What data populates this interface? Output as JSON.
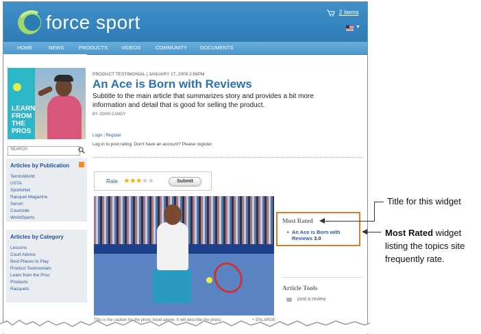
{
  "header": {
    "logo_text": "force sport",
    "cart_label": "2 items"
  },
  "nav": {
    "items": [
      "HOME",
      "NEWS",
      "PRODUCTS",
      "VIDEOS",
      "COMMUNITY",
      "DOCUMENTS"
    ]
  },
  "sidebar": {
    "promo_text": [
      "LEARN",
      "FROM",
      "THE",
      "PROS"
    ],
    "search_placeholder": "SEARCH",
    "publication": {
      "title": "Articles by Publication",
      "items": [
        "TennisWorld",
        "USTA",
        "SportsNet",
        "Racquet Magazine",
        "Serve!",
        "Courtside",
        "WorldSports"
      ]
    },
    "category": {
      "title": "Articles by Category",
      "items": [
        "Lessons",
        "Court Advice",
        "Best Places to Play",
        "Product Testimonials",
        "Learn from the Pros",
        "Products",
        "Racquets"
      ]
    }
  },
  "article": {
    "kicker": "PRODUCT TESTIMONIAL  |  JANUARY 17, 2009 2:56PM",
    "title": "An Ace is Born with Reviews",
    "subtitle": "Subtitle to the main article that summarizes story and provides a bit more information and detail that is good for selling the product.",
    "byline": "BY JOHN CANDY",
    "login": "Login",
    "register": "Register",
    "post_message": "Log in to post rating. Don't have an account? Please register.",
    "caption": "This is the caption for the photo listed above. It will describe the photo.",
    "enlarge": "+ ENLARGE"
  },
  "rating": {
    "label": "Rate",
    "stars_filled": 3,
    "stars_total": 5,
    "submit_label": "Submit"
  },
  "most_rated": {
    "title": "Most Rated",
    "items": [
      {
        "label": "An Ace is Born with Reviews",
        "score": "3.0"
      }
    ]
  },
  "article_tools": {
    "title": "Article Tools",
    "post_review": "post a review"
  },
  "callouts": {
    "title_label": "Title for this widget",
    "widget_bold": "Most Rated",
    "widget_rest": " widget listing the topics site frequently rate."
  },
  "colors": {
    "header_blue": "#2e7cb6",
    "link_blue": "#2b72b0",
    "highlight_orange": "#e07b26",
    "star_gold": "#e9b30f"
  }
}
